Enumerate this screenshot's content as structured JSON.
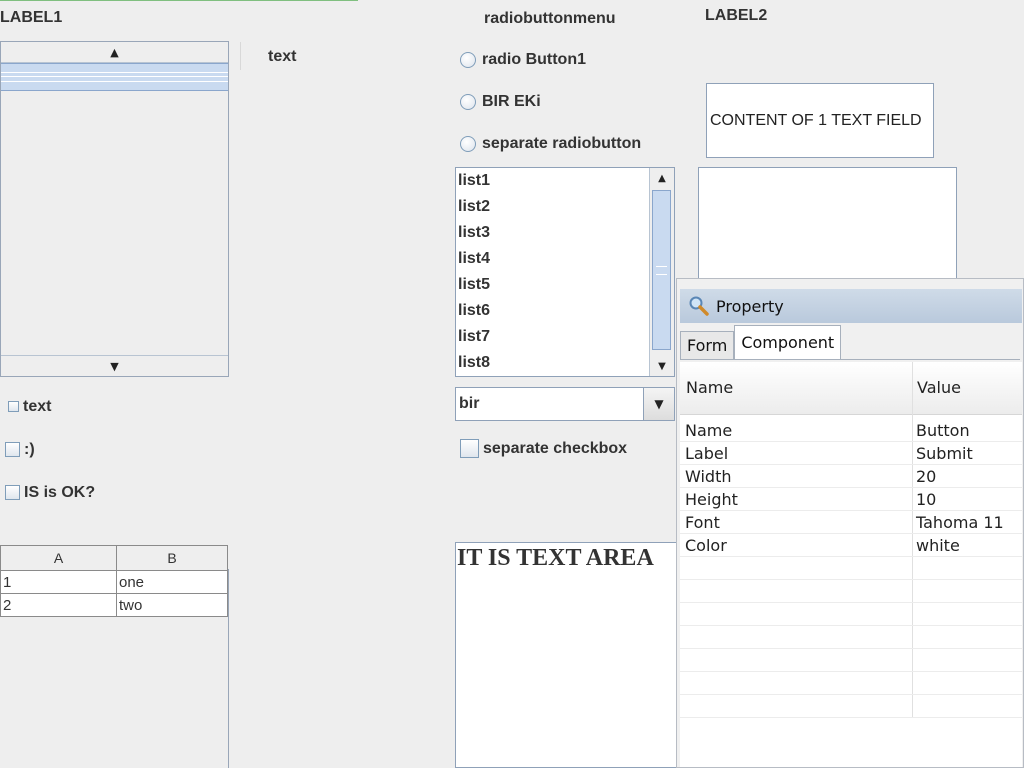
{
  "left": {
    "label1": "LABEL1",
    "text_label": "text",
    "checkboxes": [
      "text",
      ":)",
      "IS is OK?"
    ],
    "table": {
      "headers": [
        "A",
        "B"
      ],
      "rows": [
        [
          "1",
          "one"
        ],
        [
          "2",
          "two"
        ]
      ]
    }
  },
  "middle": {
    "radiobuttonmenu_label": "radiobuttonmenu",
    "radios": [
      "radio Button1",
      "BIR EKi",
      "separate radiobutton"
    ],
    "list_items": [
      "list1",
      "list2",
      "list3",
      "list4",
      "list5",
      "list6",
      "list7",
      "list8"
    ],
    "combo_value": "bir",
    "separate_checkbox": "separate checkbox",
    "text_area": "IT IS TEXT AREA"
  },
  "right": {
    "label2": "LABEL2",
    "text_field": "CONTENT OF 1 TEXT FIELD"
  },
  "property_panel": {
    "title": "Property",
    "tabs": [
      "Form",
      "Component"
    ],
    "active_tab": "Component",
    "columns": [
      "Name",
      "Value"
    ],
    "rows": [
      {
        "name": "Name",
        "value": "Button"
      },
      {
        "name": "Label",
        "value": "Submit"
      },
      {
        "name": "Width",
        "value": "20"
      },
      {
        "name": "Height",
        "value": "10"
      },
      {
        "name": "Font",
        "value": "Tahoma 11"
      },
      {
        "name": "Color",
        "value": "white"
      }
    ]
  },
  "colors": {
    "background": "#eeeeee",
    "selection_blue": "#c9daf0",
    "panel_title": "#b9c9dc"
  }
}
